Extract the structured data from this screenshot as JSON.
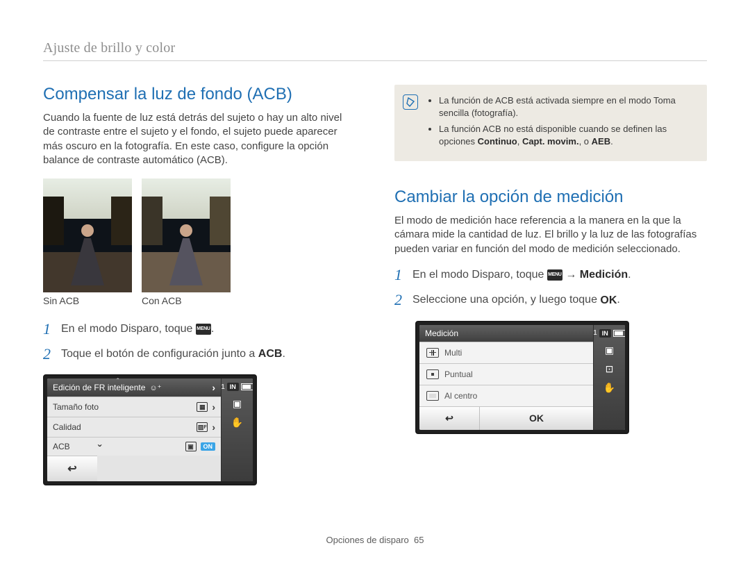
{
  "breadcrumb": "Ajuste de brillo y color",
  "left": {
    "title": "Compensar la luz de fondo (ACB)",
    "intro": "Cuando la fuente de luz está detrás del sujeto o hay un alto nivel de contraste entre el sujeto y el fondo, el sujeto puede aparecer más oscuro en la fotografía. En este caso, configure la opción balance de contraste automático (ACB).",
    "caption_a": "Sin ACB",
    "caption_b": "Con ACB",
    "steps": [
      {
        "num": "1",
        "pre": "En el modo Disparo, toque ",
        "icon": "MENU",
        "post": "."
      },
      {
        "num": "2",
        "pre": "Toque el botón de configuración junto a ",
        "bold": "ACB",
        "post": "."
      }
    ],
    "screen": {
      "title": "Edición de FR inteligente",
      "row2": "Tamaño foto",
      "row3": "Calidad",
      "row4": "ACB",
      "on": "ON",
      "status_num": "1",
      "status_in": "IN"
    }
  },
  "right": {
    "note1_pre": "La función de ACB está activada siempre en el modo Toma sencilla (fotografía).",
    "note2_pre": "La función ACB no está disponible cuando se definen las opciones ",
    "note2_bold_a": "Continuo",
    "note2_sep_a": ", ",
    "note2_bold_b": "Capt. movim.",
    "note2_sep_b": ", o ",
    "note2_bold_c": "AEB",
    "note2_post": ".",
    "title": "Cambiar la opción de medición",
    "intro": "El modo de medición hace referencia a la manera en la que la cámara mide la cantidad de luz. El brillo y la luz de las fotografías pueden variar en función del modo de medición seleccionado.",
    "steps": [
      {
        "num": "1",
        "pre": "En el modo Disparo, toque ",
        "icon": "MENU",
        "mid": " → ",
        "bold": "Medición",
        "post": "."
      },
      {
        "num": "2",
        "pre": "Seleccione una opción, y luego toque ",
        "okicon": "OK",
        "post": "."
      }
    ],
    "screen": {
      "title": "Medición",
      "opt1": "Multi",
      "opt2": "Puntual",
      "opt3": "Al centro",
      "ok": "OK",
      "status_num": "1",
      "status_in": "IN"
    }
  },
  "footer_label": "Opciones de disparo",
  "footer_page": "65"
}
